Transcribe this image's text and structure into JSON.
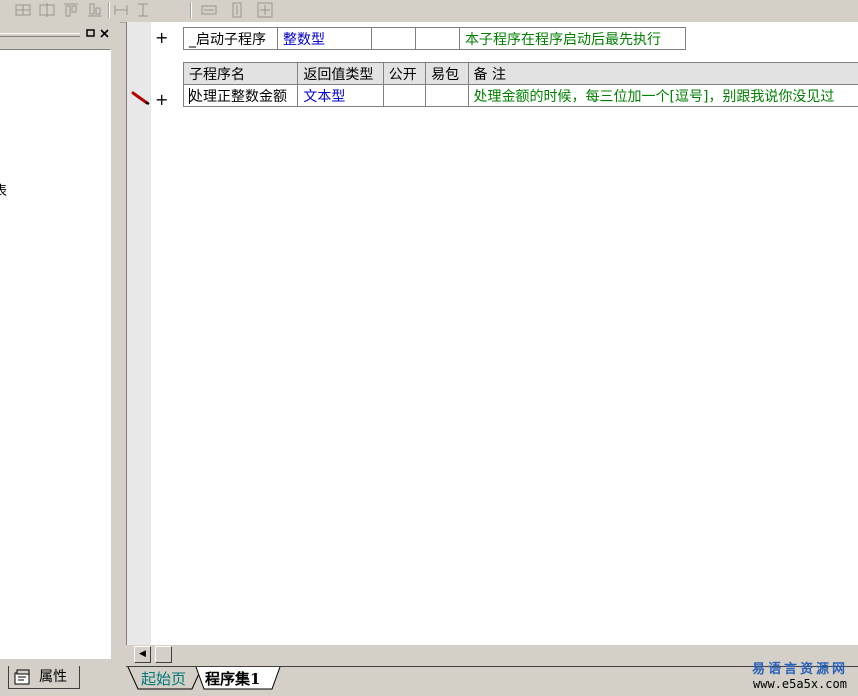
{
  "left_panel": {
    "tab_label": "属性",
    "tree_glyph": "表"
  },
  "editor": {
    "top_row": {
      "plus": "+",
      "name": "_启动子程序",
      "type": "整数型",
      "public": "",
      "package": "",
      "remark": "本子程序在程序启动后最先执行"
    },
    "headers": [
      "子程序名",
      "返回值类型",
      "公开",
      "易包",
      "备 注"
    ],
    "rows": [
      {
        "plus": "+",
        "name": "处理正整数金额",
        "type": "文本型",
        "public": "",
        "package": "",
        "remark": "处理金额的时候，每三位加一个[逗号]，别跟我说你没见过"
      }
    ]
  },
  "scrollbar": {
    "left_arrow": "◀"
  },
  "bottom_tabs": {
    "start": "起始页",
    "active": "程序集1"
  },
  "watermark": {
    "line1": "易语言资源网",
    "line2": "www.e5a5x.com"
  },
  "colors": {
    "accent_blue": "#0000d0",
    "remark_green": "#008000",
    "chrome": "#d4d0c8"
  }
}
